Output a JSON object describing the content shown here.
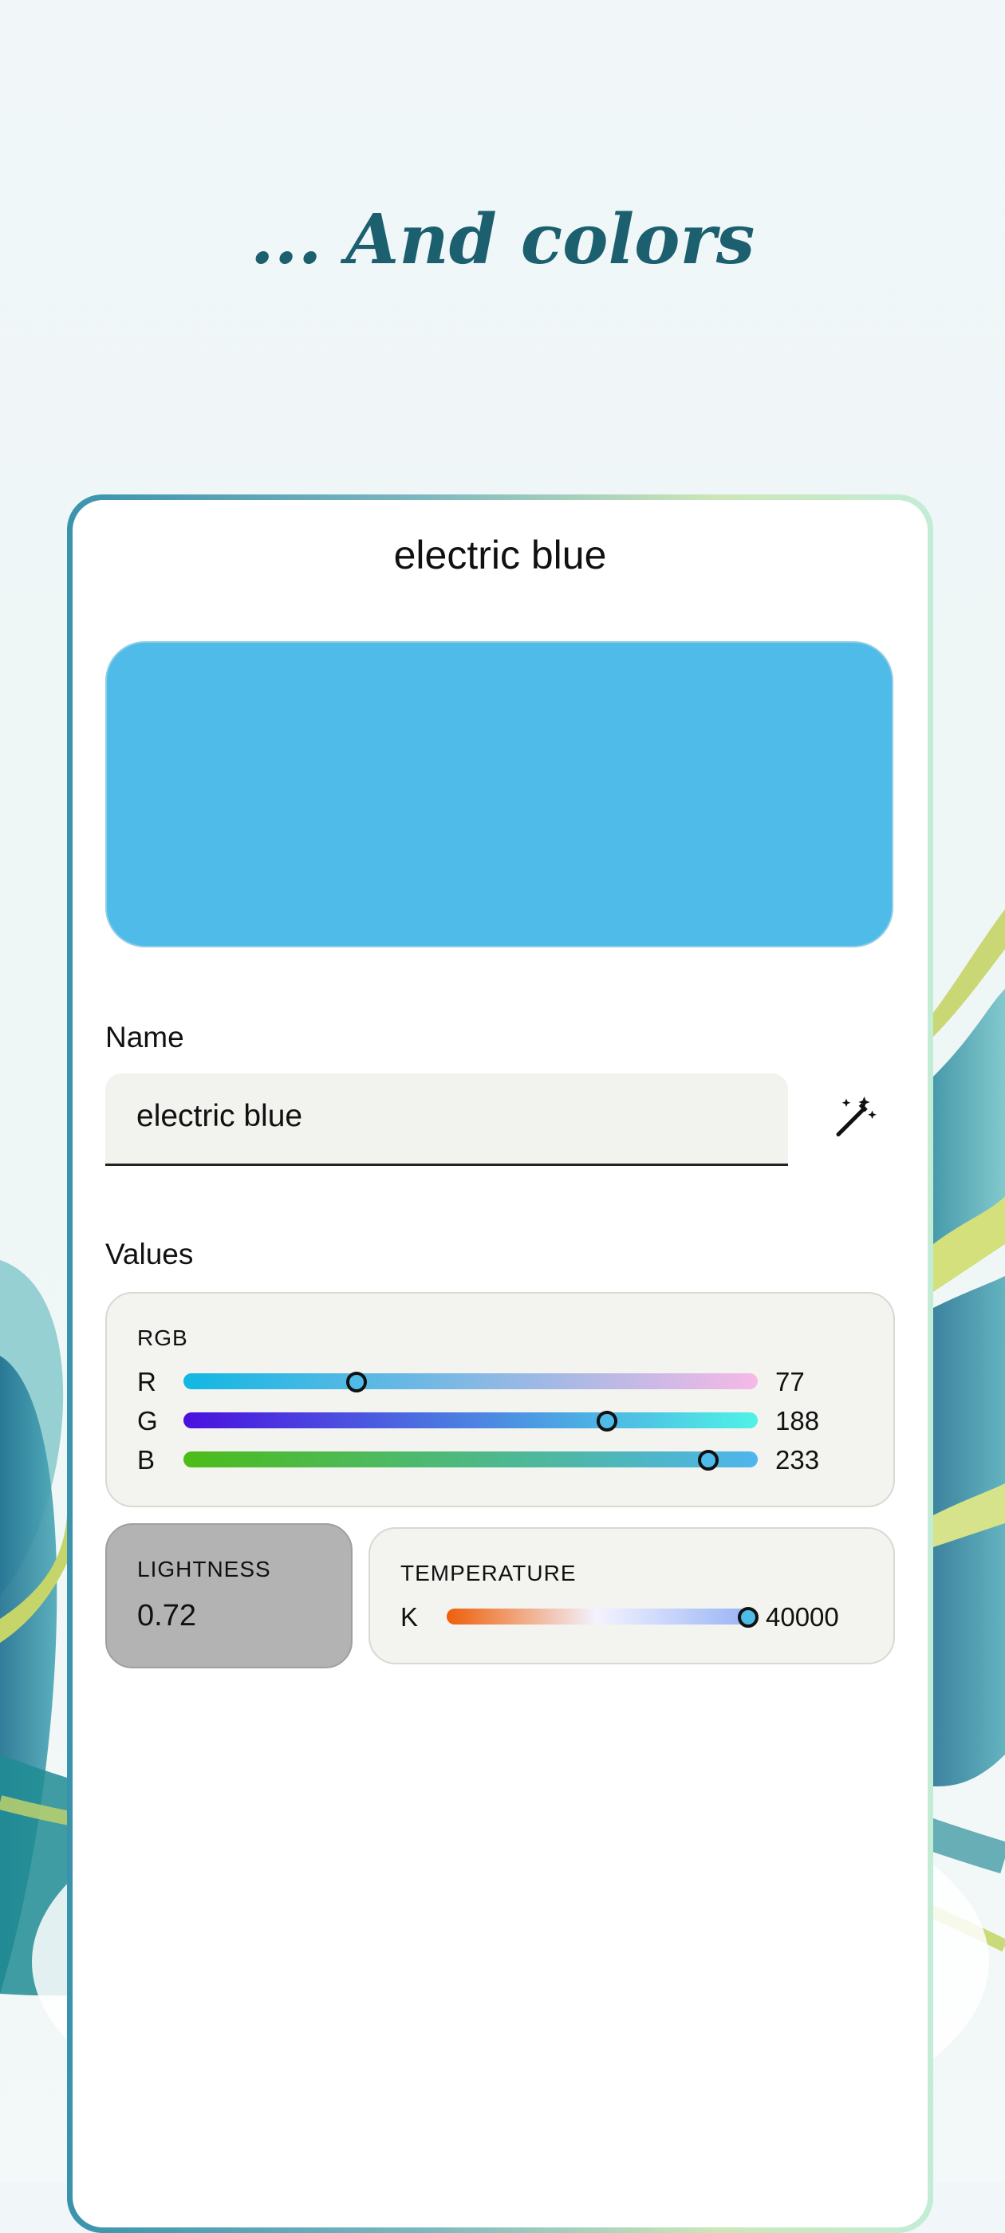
{
  "headline": "... And colors",
  "card": {
    "title": "electric blue",
    "swatch_color": "#4fbbe8"
  },
  "name_section": {
    "label": "Name",
    "value": "electric blue",
    "generate_icon": "magic-wand-icon"
  },
  "values_section": {
    "label": "Values",
    "rgb": {
      "caption": "RGB",
      "channels": [
        {
          "name": "R",
          "value": "77",
          "fraction": 0.302
        },
        {
          "name": "G",
          "value": "188",
          "fraction": 0.737
        },
        {
          "name": "B",
          "value": "233",
          "fraction": 0.914
        }
      ]
    },
    "lightness": {
      "caption": "LIGHTNESS",
      "value": "0.72"
    },
    "temperature": {
      "caption": "TEMPERATURE",
      "unit": "K",
      "value": "40000",
      "fraction": 1.0
    }
  },
  "colors": {
    "headline": "#1c5f6f",
    "r_track": [
      "#10b8e3",
      "#f6b9e6"
    ],
    "g_track": [
      "#4a10de",
      "#4ef3e6"
    ],
    "b_track": [
      "#4cbc17",
      "#4fb5ef"
    ],
    "temp_track": [
      "#ee5f0a",
      "#f3f3ff",
      "#9ab4f5"
    ]
  }
}
